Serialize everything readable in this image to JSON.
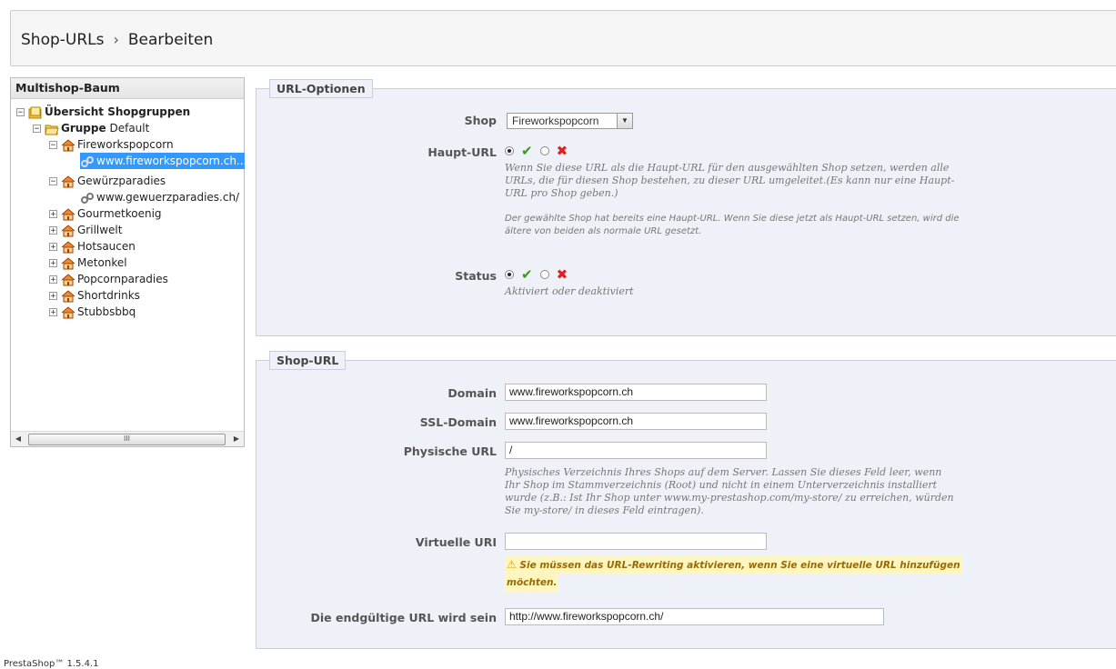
{
  "breadcrumb": {
    "first": "Shop-URLs",
    "sep": "›",
    "second": "Bearbeiten"
  },
  "tree": {
    "title": "Multishop-Baum",
    "root": "Übersicht Shopgruppen",
    "group_label": "Gruppe",
    "group_name": "Default",
    "shops": [
      {
        "name": "Fireworkspopcorn",
        "expanded": true,
        "url": "www.fireworkspopcorn.ch..."
      },
      {
        "name": "Gewürzparadies",
        "expanded": true,
        "url": "www.gewuerzparadies.ch/"
      },
      {
        "name": "Gourmetkoenig",
        "expanded": false
      },
      {
        "name": "Grillwelt",
        "expanded": false
      },
      {
        "name": "Hotsaucen",
        "expanded": false
      },
      {
        "name": "Metonkel",
        "expanded": false
      },
      {
        "name": "Popcornparadies",
        "expanded": false
      },
      {
        "name": "Shortdrinks",
        "expanded": false
      },
      {
        "name": "Stubbsbbq",
        "expanded": false
      }
    ],
    "scroll_thumb": "III"
  },
  "url_options": {
    "legend": "URL-Optionen",
    "shop_label": "Shop",
    "shop_value": "Fireworkspopcorn",
    "main_url_label": "Haupt-URL",
    "main_url_hint": "Wenn Sie diese URL als die Haupt-URL für den ausgewählten Shop setzen, werden alle URLs, die für diesen Shop bestehen, zu dieser URL umgeleitet.(Es kann nur eine Haupt-URL pro Shop geben.)",
    "main_url_hint2": "Der gewählte Shop hat bereits eine Haupt-URL. Wenn Sie diese jetzt als Haupt-URL setzen, wird die ältere von beiden als normale URL gesetzt.",
    "status_label": "Status",
    "status_hint": "Aktiviert oder deaktiviert"
  },
  "shop_url": {
    "legend": "Shop-URL",
    "domain_label": "Domain",
    "domain_value": "www.fireworkspopcorn.ch",
    "ssl_label": "SSL-Domain",
    "ssl_value": "www.fireworkspopcorn.ch",
    "physical_label": "Physische URL",
    "physical_value": "/",
    "physical_hint": "Physisches Verzeichnis Ihres Shops auf dem Server. Lassen Sie dieses Feld leer, wenn Ihr Shop im Stammverzeichnis (Root) und nicht in einem Unterverzeichnis installiert wurde (z.B.: Ist Ihr Shop unter www.my-prestashop.com/my-store/ zu erreichen, würden Sie my-store/ in dieses Feld eintragen).",
    "virtual_label": "Virtuelle URI",
    "virtual_value": "",
    "virtual_warning_line1": "Sie müssen das URL-Rewriting aktivieren, wenn Sie eine virtuelle URL hinzufügen",
    "virtual_warning_line2": "möchten.",
    "final_label": "Die endgültige URL wird sein",
    "final_value": "http://www.fireworkspopcorn.ch/"
  },
  "footer": "PrestaShop™ 1.5.4.1",
  "colors": {
    "selected": "#3399ff",
    "panel": "#eef1f7",
    "check": "#3a9a1a",
    "cross": "#e02020",
    "warning_bg": "#fff6bf"
  }
}
